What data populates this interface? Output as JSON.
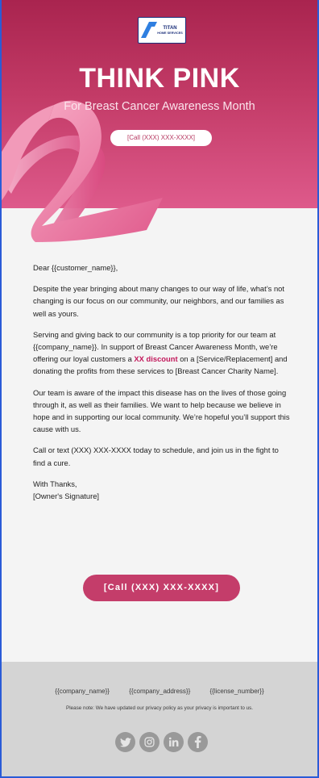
{
  "logo": {
    "brand": "TITAN",
    "subtitle": "HOME SERVICES"
  },
  "hero": {
    "title": "THINK PINK",
    "subtitle": "For Breast Cancer Awareness Month",
    "phone_button": "[Call (XXX) XXX-XXXX]"
  },
  "letter": {
    "greeting": "Dear {{customer_name}},",
    "p1": "Despite the year bringing about many changes to our way of life, what’s not changing is our focus on our community, our neighbors, and our families as well as yours.",
    "p2_before": "Serving and giving back to our community is a top priority for our team at {{company_name}}. In support of Breast Cancer Awareness Month, we’re offering our loyal customers a ",
    "p2_discount": "XX discount",
    "p2_after": " on a [Service/Replacement] and donating the profits from these services to [Breast Cancer Charity Name].",
    "p3": "Our team is aware of the impact this disease has on the lives of those going through it, as well as their families. We want to help because we believe in hope and in supporting our local community. We’re hopeful you’ll support this cause with us.",
    "p4": "Call or text (XXX) XXX-XXXX today to schedule, and join us in the fight to find a cure.",
    "signoff": "With Thanks,",
    "signature": "[Owner's Signature]"
  },
  "cta": {
    "label": "[Call (XXX) XXX-XXXX]"
  },
  "footer": {
    "company_name": "{{company_name}}",
    "company_address": "{{company_address}}",
    "license_number": "{{license_number}}",
    "privacy": "Please note: We have updated our privacy policy as your privacy is important to us.",
    "socials": [
      "twitter-icon",
      "instagram-icon",
      "linkedin-icon",
      "facebook-icon"
    ]
  },
  "colors": {
    "hero_top": "#a9244f",
    "hero_bottom": "#de5a8b",
    "accent": "#c43d6a",
    "discount": "#c2185b",
    "footer_bg": "#d4d4d4"
  }
}
